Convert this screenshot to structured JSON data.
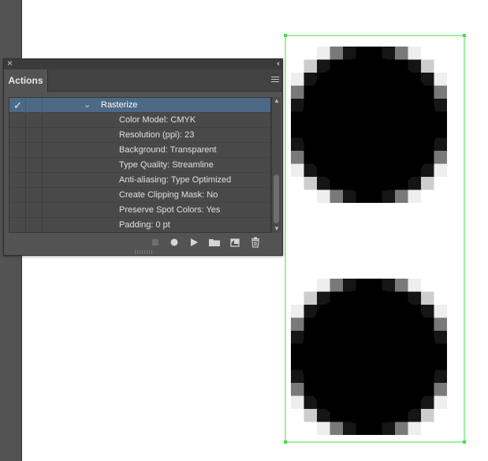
{
  "panel": {
    "close_glyph": "×",
    "collapse_glyph": "‹‹",
    "tab_label": "Actions",
    "menu_icon": "hamburger-menu-icon"
  },
  "actions_list": {
    "parent": {
      "label": "Rasterize",
      "checked": true,
      "expanded": true,
      "chevron": "⌄",
      "check": "✓"
    },
    "items": [
      {
        "label": "Color Model: CMYK"
      },
      {
        "label": "Resolution (ppi): 23"
      },
      {
        "label": "Background: Transparent"
      },
      {
        "label": "Type Quality: Streamline"
      },
      {
        "label": "Anti-aliasing: Type Optimized"
      },
      {
        "label": "Create Clipping Mask: No"
      },
      {
        "label": "Preserve Spot Colors: Yes"
      },
      {
        "label": "Padding: 0 pt"
      }
    ]
  },
  "toolbar": {
    "buttons": [
      {
        "name": "stop-playing-button",
        "icon": "stop-icon"
      },
      {
        "name": "begin-recording-button",
        "icon": "record-icon"
      },
      {
        "name": "play-selection-button",
        "icon": "play-icon"
      },
      {
        "name": "create-new-set-button",
        "icon": "folder-icon"
      },
      {
        "name": "create-new-action-button",
        "icon": "new-item-icon"
      },
      {
        "name": "delete-selection-button",
        "icon": "trash-icon"
      }
    ]
  },
  "colors": {
    "selection_bounds": "#3fe03f",
    "selected_row": "#4c6a86",
    "panel_bg": "#535353",
    "artwork_fill": "#000000"
  }
}
